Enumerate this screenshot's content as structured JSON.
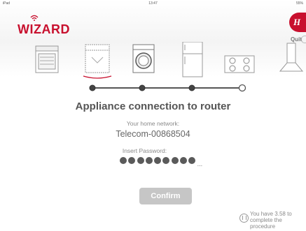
{
  "status_bar": {
    "device": "iPad",
    "time": "13:47",
    "battery": "55% "
  },
  "brand": {
    "app_name": "WIZARD",
    "manufacturer_logo": "hoover-logo"
  },
  "header": {
    "quit_label": "Quit"
  },
  "appliances": [
    {
      "name": "oven-icon",
      "selected": false
    },
    {
      "name": "dishwasher-icon",
      "selected": true
    },
    {
      "name": "washing-machine-icon",
      "selected": false
    },
    {
      "name": "fridge-icon",
      "selected": false
    },
    {
      "name": "hob-icon",
      "selected": false
    },
    {
      "name": "hood-icon",
      "selected": false
    }
  ],
  "steps": {
    "completed": 3,
    "total": 4
  },
  "main": {
    "title": "Appliance connection to router",
    "network_label": "Your home network:",
    "network_name": "Telecom-00868504",
    "password_label": "Insert Password:",
    "password_dots": 9,
    "confirm_label": "Confirm"
  },
  "timer": {
    "text": "You have 3.58 to complete the procedure"
  },
  "colors": {
    "brand_red": "#c8102e",
    "button_gray": "#c6c6c6",
    "text_gray": "#555555"
  }
}
